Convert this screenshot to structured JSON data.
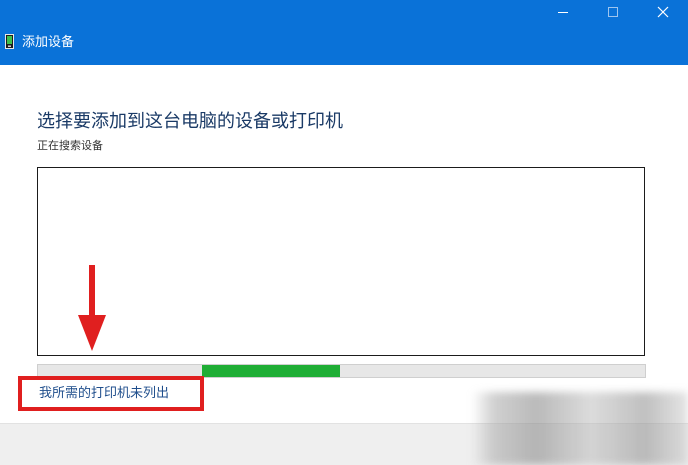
{
  "window": {
    "title": "添加设备",
    "app_icon": "device-icon",
    "controls": {
      "minimize_icon": "minimize-icon",
      "maximize_icon": "maximize-icon",
      "close_icon": "close-icon"
    }
  },
  "main": {
    "heading": "选择要添加到这台电脑的设备或打印机",
    "status": "正在搜索设备",
    "device_list": [],
    "progress": {
      "state": "indeterminate",
      "fill_color": "#1fae35"
    },
    "printer_not_listed_link": "我所需的打印机未列出"
  },
  "annotations": {
    "highlight_color": "#e01f1f",
    "arrow_icon": "arrow-down-icon"
  },
  "colors": {
    "titlebar": "#0a72d8",
    "heading": "#1a3a66",
    "link": "#1f4e8c"
  }
}
